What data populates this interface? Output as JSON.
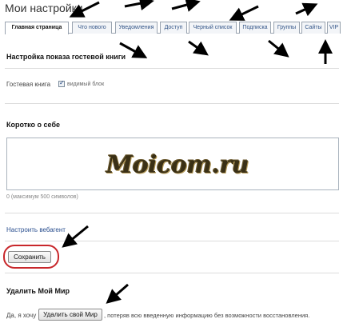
{
  "page_title": "Мои настройки",
  "tabs": [
    {
      "label": "Главная страница",
      "active": true
    },
    {
      "label": "Что нового",
      "active": false
    },
    {
      "label": "Уведомления",
      "active": false
    },
    {
      "label": "Доступ",
      "active": false
    },
    {
      "label": "Черный список",
      "active": false
    },
    {
      "label": "Подписка",
      "active": false
    },
    {
      "label": "Группы",
      "active": false
    },
    {
      "label": "Сайты",
      "active": false
    },
    {
      "label": "VIP",
      "active": false
    }
  ],
  "guestbook": {
    "title": "Настройка показа гостевой книги",
    "label": "Гостевая книга",
    "checkbox_label": "видимый блок"
  },
  "about": {
    "title": "Коротко о себе",
    "watermark": "Moicom.ru",
    "hint": "0 (максимум 500 символов)"
  },
  "links": {
    "wedge": "Настроить вебагент"
  },
  "save_button": "Сохранить",
  "delete": {
    "title": "Удалить Мой Мир",
    "prefix": "Да, я хочу",
    "button": "Удалить свой Мир",
    "suffix": ", потеряв всю введенную информацию без возможности восстановления."
  }
}
